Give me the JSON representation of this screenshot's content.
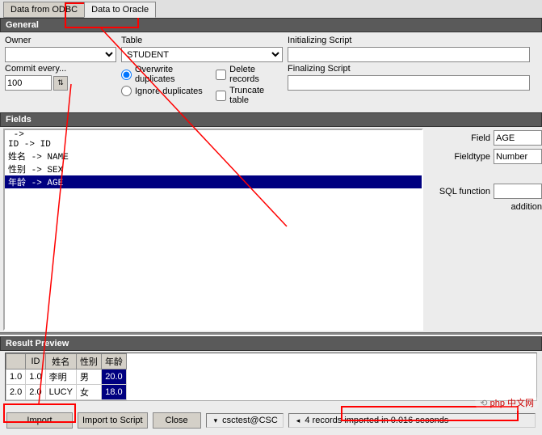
{
  "tabs": {
    "odbc": "Data from ODBC",
    "oracle": "Data to Oracle"
  },
  "section_general": "General",
  "general": {
    "owner_label": "Owner",
    "table_label": "Table",
    "table_value": "STUDENT",
    "commit_label": "Commit every...",
    "commit_value": "100",
    "overwrite": "Overwrite duplicates",
    "ignore": "Ignore duplicates",
    "delete": "Delete records",
    "truncate": "Truncate table",
    "init_label": "Initializing Script",
    "final_label": "Finalizing Script"
  },
  "section_fields": "Fields",
  "fields": {
    "items": [
      " ->",
      "ID -> ID",
      "姓名 -> NAME",
      "性别 -> SEX",
      "年龄 -> AGE"
    ],
    "selected_index": 4
  },
  "field_props": {
    "field_label": "Field",
    "field_value": "AGE",
    "fieldtype_label": "Fieldtype",
    "fieldtype_value": "Number",
    "sql_label": "SQL function",
    "additional": "addition"
  },
  "section_result": "Result Preview",
  "result": {
    "columns": [
      "",
      "ID",
      "姓名",
      "性别",
      "年龄"
    ],
    "rows": [
      [
        "1.0",
        "1.0",
        "李明",
        "男",
        "20.0"
      ],
      [
        "2.0",
        "2.0",
        "LUCY",
        "女",
        "18.0"
      ]
    ]
  },
  "buttons": {
    "import": "Import",
    "import_script": "Import to Script",
    "close": "Close"
  },
  "connection": "csctest@CSC",
  "status": "4 records imported in 0.016 seconds",
  "watermark": "php 中文网"
}
